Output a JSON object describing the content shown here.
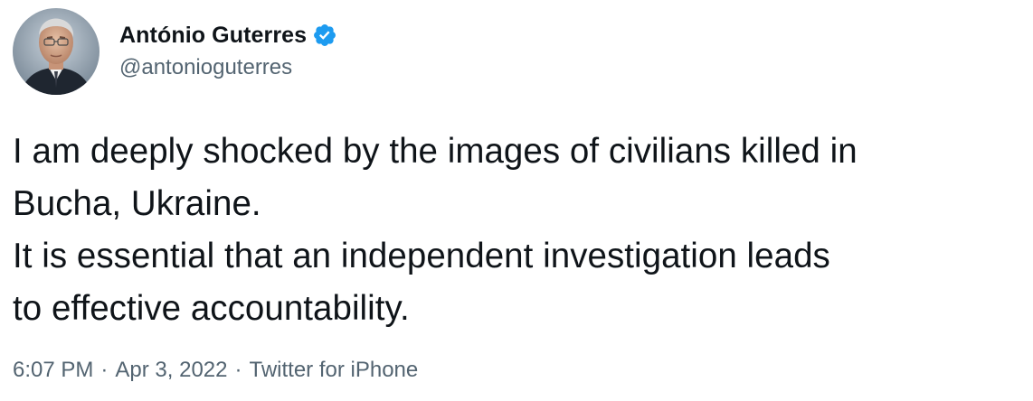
{
  "author": {
    "name": "António Guterres",
    "handle": "@antonioguterres",
    "verified": true,
    "avatar": "portrait-photo"
  },
  "tweet": {
    "lines": [
      "I am deeply shocked by the images of civilians killed in",
      "Bucha, Ukraine.",
      "It is essential that an independent investigation leads",
      "to effective accountability."
    ]
  },
  "meta": {
    "time": "6:07 PM",
    "separator": "·",
    "date": "Apr 3, 2022",
    "source": "Twitter for iPhone"
  },
  "colors": {
    "text": "#0f1419",
    "secondary": "#536471",
    "verified_badge": "#1d9bf0"
  },
  "icons": {
    "verified": "verified-badge-icon"
  }
}
